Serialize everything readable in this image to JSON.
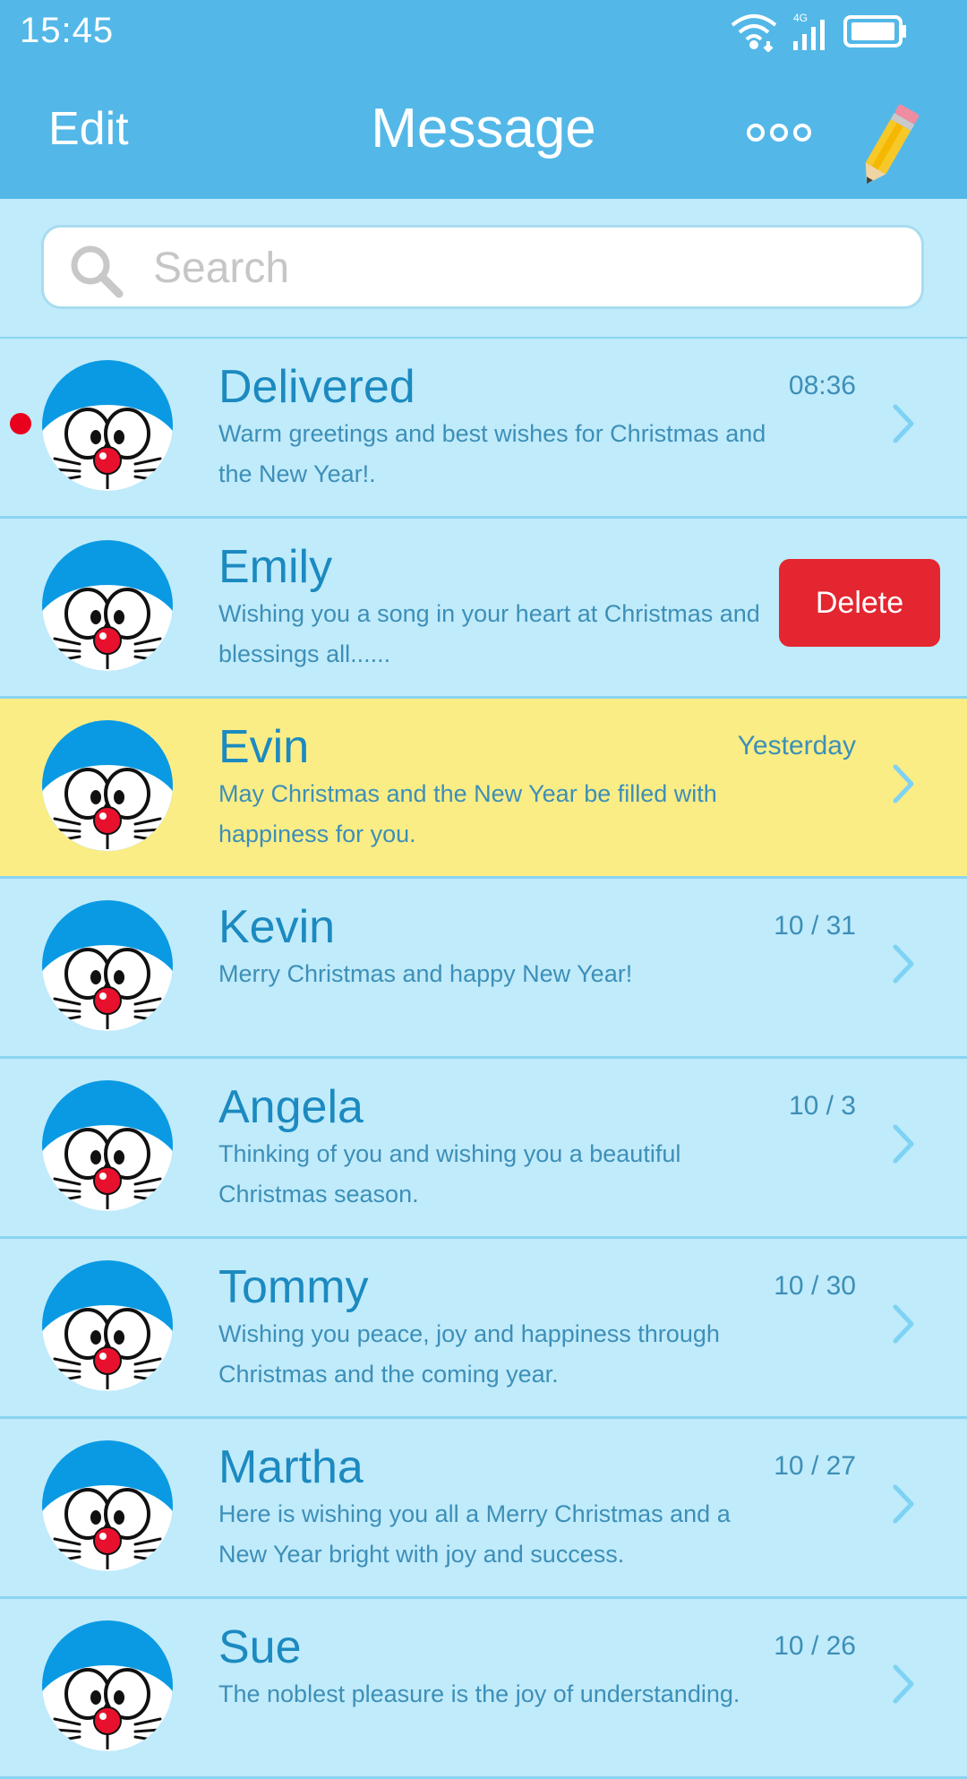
{
  "status_bar": {
    "time": "15:45",
    "network": "4G",
    "icons": [
      "wifi-icon",
      "signal-icon",
      "battery-icon"
    ]
  },
  "nav": {
    "edit_label": "Edit",
    "title": "Message",
    "more_icon": "more-icon",
    "compose_icon": "pencil-icon"
  },
  "search": {
    "placeholder": "Search"
  },
  "colors": {
    "header": "#53b8e8",
    "list_bg": "#c0ebfb",
    "highlight": "#fbed85",
    "delete": "#e3262f",
    "unread": "#e8001d",
    "text": "#1c8ac0"
  },
  "conversations": [
    {
      "name": "Delivered",
      "time": "08:36",
      "preview": "Warm greetings and best wishes for Christmas and the New Year!.",
      "unread": true
    },
    {
      "name": "Emily",
      "time": "",
      "preview": "Wishing you a song in your heart at Christmas and blessings all......",
      "swiped": true,
      "delete_label": "Delete"
    },
    {
      "name": "Evin",
      "time": "Yesterday",
      "preview": "May Christmas and the New Year be filled with happiness for you.",
      "highlighted": true
    },
    {
      "name": "Kevin",
      "time": "10 / 31",
      "preview": "Merry Christmas and happy New Year!"
    },
    {
      "name": "Angela",
      "time": "10 / 3",
      "preview": "Thinking of you and wishing you a beautiful Christmas season."
    },
    {
      "name": "Tommy",
      "time": "10 / 30",
      "preview": "Wishing you peace, joy and happiness through Christmas and the coming year."
    },
    {
      "name": "Martha",
      "time": "10 / 27",
      "preview": "Here is wishing you all a Merry Christmas and a New Year bright with joy and success."
    },
    {
      "name": "Sue",
      "time": "10 / 26",
      "preview": "The noblest pleasure is the joy of understanding."
    }
  ]
}
